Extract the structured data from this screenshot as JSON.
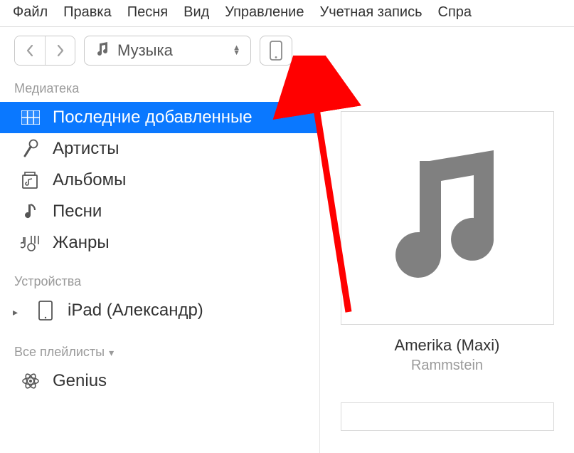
{
  "menu": {
    "file": "Файл",
    "edit": "Правка",
    "song": "Песня",
    "view": "Вид",
    "controls": "Управление",
    "account": "Учетная запись",
    "help": "Спра"
  },
  "toolbar": {
    "back": "‹",
    "forward": "›",
    "dropdown_label": "Музыка"
  },
  "sidebar": {
    "library_header": "Медиатека",
    "library": [
      {
        "icon": "grid",
        "label": "Последние добавленные",
        "selected": true
      },
      {
        "icon": "mic",
        "label": "Артисты"
      },
      {
        "icon": "album",
        "label": "Альбомы"
      },
      {
        "icon": "note",
        "label": "Песни"
      },
      {
        "icon": "genres",
        "label": "Жанры"
      }
    ],
    "devices_header": "Устройства",
    "devices": [
      {
        "icon": "ipad",
        "label": "iPad (Александр)"
      }
    ],
    "playlists_header": "Все плейлисты",
    "playlists": [
      {
        "icon": "genius",
        "label": "Genius"
      }
    ]
  },
  "main": {
    "album_title": "Amerika (Maxi)",
    "album_artist": "Rammstein"
  }
}
